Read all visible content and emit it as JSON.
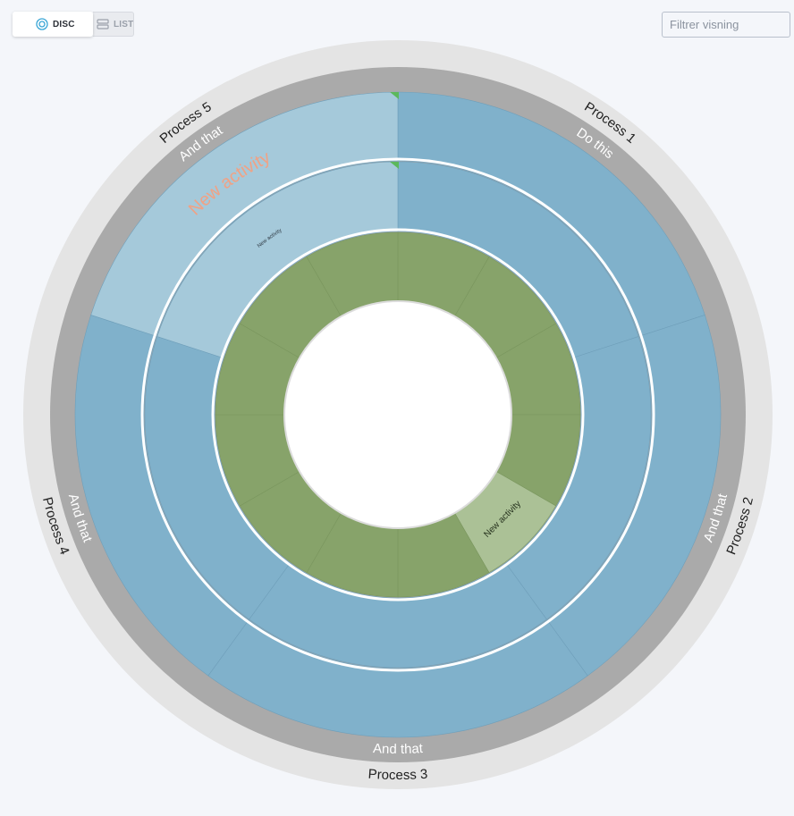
{
  "toolbar": {
    "disc_label": "DISC",
    "list_label": "LISTE",
    "disc_icon": "disc-icon",
    "list_icon": "list-icon",
    "active_view": "DISC"
  },
  "filter": {
    "placeholder": "Filtrer visning",
    "value": ""
  },
  "colors": {
    "outer_ring": "#e4e4e4",
    "process_ring": "#aaaaaa",
    "activity_blue": "#80b1cb",
    "activity_blue_highlight": "#a5c9da",
    "task_green": "#87a36a",
    "task_green_highlight": "#abc196",
    "new_activity_text": "#f0a285",
    "marker_green": "#5cb85c"
  },
  "processes": [
    {
      "name": "Process 1",
      "activity": "Do this"
    },
    {
      "name": "Process 2",
      "activity": "And that"
    },
    {
      "name": "Process 3",
      "activity": "And that"
    },
    {
      "name": "Process 4",
      "activity": "And that"
    },
    {
      "name": "Process 5",
      "activity": "And that"
    }
  ],
  "highlighted_activity": {
    "process": "Process 5",
    "outer_label": "New activity",
    "inner_label": "New activity"
  },
  "task_ring": {
    "segment_count": 12,
    "highlighted_label": "New activity"
  }
}
